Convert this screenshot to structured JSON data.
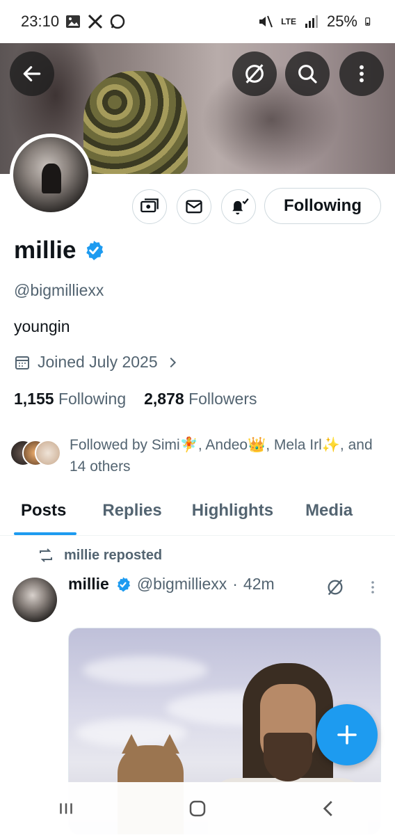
{
  "status_bar": {
    "time": "23:10",
    "network": "LTE",
    "battery": "25%",
    "left_icons": [
      "gallery-icon",
      "x-icon",
      "whatsapp-icon"
    ],
    "right_icons": [
      "mute-icon",
      "lte-icon",
      "signal-icon",
      "battery-icon"
    ]
  },
  "header": {
    "back_icon": "back-arrow-icon",
    "grok_icon": "grok-icon",
    "search_icon": "search-icon",
    "more_icon": "more-vertical-icon"
  },
  "profile": {
    "name": "millie",
    "verified": true,
    "handle": "@bigmilliexx",
    "bio": "youngin",
    "joined": "Joined July 2025",
    "following_count": "1,155",
    "following_label": "Following",
    "followers_count": "2,878",
    "followers_label": "Followers",
    "followed_by": "Followed by Simi🧚, Andeo👑, Mela Irl✨, and 14 others"
  },
  "actions": {
    "subscribe_icon": "money-icon",
    "message_icon": "mail-icon",
    "notify_icon": "bell-check-icon",
    "follow_label": "Following"
  },
  "tabs": [
    {
      "label": "Posts",
      "active": true
    },
    {
      "label": "Replies",
      "active": false
    },
    {
      "label": "Highlights",
      "active": false
    },
    {
      "label": "Media",
      "active": false
    }
  ],
  "post": {
    "repost_label": "millie reposted",
    "author_name": "millie",
    "author_handle": "@bigmilliexx",
    "separator": "·",
    "time_ago": "42m"
  },
  "colors": {
    "accent": "#1d9bf0",
    "text_primary": "#0f1419",
    "text_secondary": "#536471",
    "border": "#cfd9de"
  }
}
